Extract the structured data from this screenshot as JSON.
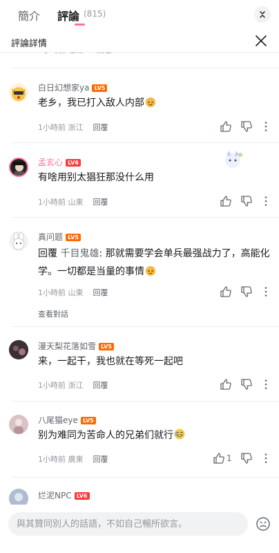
{
  "tabs": {
    "intro": "簡介",
    "comments": "評論",
    "count": "(815)"
  },
  "detail": {
    "title": "評論詳情"
  },
  "peek": {
    "a": "1小時前 杜江",
    "b": "回覆"
  },
  "comments": [
    {
      "user": "白日幻想家ya",
      "level": "LV5",
      "text": "老乡，我已打入敌人内部",
      "time": "1小時前 浙江",
      "reply_label": "回覆"
    },
    {
      "user": "孟玄心",
      "level": "LV6",
      "text": "有啥用别太猖狂那没什么用",
      "time": "1小時前 山東",
      "reply_label": "回覆"
    },
    {
      "user": "真问题",
      "level": "LV5",
      "reply_prefix": "回覆",
      "reply_to": "千目鬼雄",
      "text": ": 那就需要学会单兵最强战力了，高能化学。一切都是当量的事情",
      "time": "1小時前 山東",
      "reply_label": "回覆",
      "view_conversation": "查看對話"
    },
    {
      "user": "漫天梨花落如雪",
      "level": "LV5",
      "text": "来，一起干，我也就在等死一起吧",
      "time": "1小時前 浙江",
      "reply_label": "回覆"
    },
    {
      "user": "八尾猫eye",
      "level": "LV5",
      "text": "别为难同为苦命人的兄弟们就行",
      "time": "1小時前 廣東",
      "reply_label": "回覆",
      "likes": "1"
    },
    {
      "user": "烂泥NPC",
      "level": "LV6",
      "text": "",
      "time": "",
      "reply_label": ""
    }
  ],
  "composer": {
    "placeholder": "與其贊同別人的話語，不如自己暢所欲言。"
  },
  "colors": {
    "accent": "#fb7299",
    "lv5": "#ff6a00",
    "lv6": "#fb3a3a"
  },
  "icons": [
    "chevron-collapse-icon",
    "close-icon",
    "thumb-up-icon",
    "thumb-down-icon",
    "more-icon",
    "emoji-icon"
  ]
}
